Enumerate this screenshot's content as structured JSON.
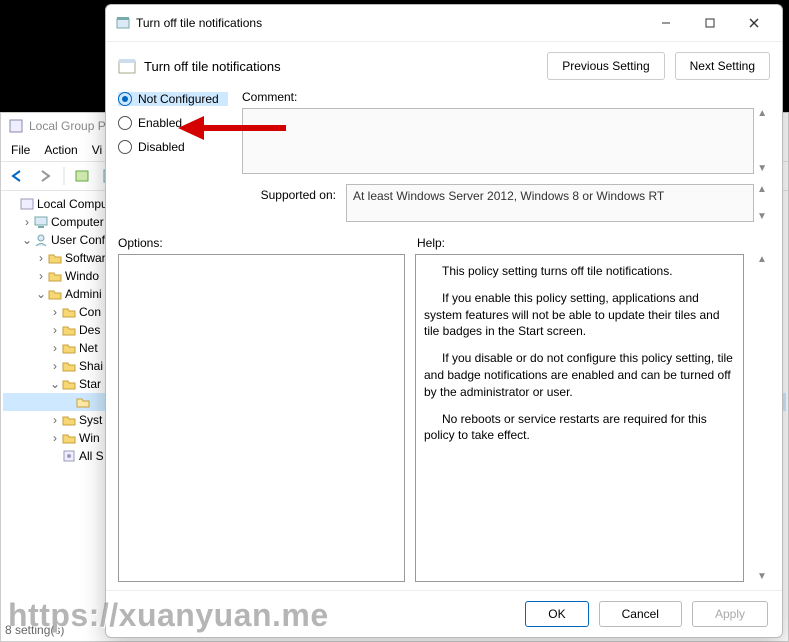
{
  "bg_window": {
    "title": "Local Group P",
    "menu": [
      "File",
      "Action",
      "Vi"
    ],
    "tree": [
      {
        "indent": 0,
        "exp": "",
        "icon": "policy",
        "label": "Local Compute"
      },
      {
        "indent": 1,
        "exp": ">",
        "icon": "computer",
        "label": "Computer"
      },
      {
        "indent": 1,
        "exp": "v",
        "icon": "user",
        "label": "User Config"
      },
      {
        "indent": 2,
        "exp": ">",
        "icon": "folder",
        "label": "Softwar"
      },
      {
        "indent": 2,
        "exp": ">",
        "icon": "folder",
        "label": "Windo"
      },
      {
        "indent": 2,
        "exp": "v",
        "icon": "folder",
        "label": "Admini"
      },
      {
        "indent": 3,
        "exp": ">",
        "icon": "folder",
        "label": "Con"
      },
      {
        "indent": 3,
        "exp": ">",
        "icon": "folder",
        "label": "Des"
      },
      {
        "indent": 3,
        "exp": ">",
        "icon": "folder",
        "label": "Net"
      },
      {
        "indent": 3,
        "exp": ">",
        "icon": "folder",
        "label": "Shai"
      },
      {
        "indent": 3,
        "exp": "v",
        "icon": "folder",
        "label": "Star"
      },
      {
        "indent": 4,
        "exp": "",
        "icon": "folder-sel",
        "label": ""
      },
      {
        "indent": 3,
        "exp": ">",
        "icon": "folder",
        "label": "Syst"
      },
      {
        "indent": 3,
        "exp": ">",
        "icon": "folder",
        "label": "Win"
      },
      {
        "indent": 3,
        "exp": "",
        "icon": "settings",
        "label": "All S"
      }
    ],
    "status": "8 setting(s)"
  },
  "dialog": {
    "title": "Turn off tile notifications",
    "header_title": "Turn off tile notifications",
    "prev_btn": "Previous Setting",
    "next_btn": "Next Setting",
    "radios": {
      "not_configured": "Not Configured",
      "enabled": "Enabled",
      "disabled": "Disabled"
    },
    "comment_label": "Comment:",
    "comment_value": "",
    "supported_label": "Supported on:",
    "supported_value": "At least Windows Server 2012, Windows 8 or Windows RT",
    "options_label": "Options:",
    "help_label": "Help:",
    "help_paragraphs": [
      "This policy setting turns off tile notifications.",
      "If you enable this policy setting, applications and system features will not be able to update their tiles and tile badges in the Start screen.",
      "If you disable or do not configure this policy setting, tile and badge notifications are enabled and can be turned off by the administrator or user.",
      "No reboots or service restarts are required for this policy to take effect."
    ],
    "ok": "OK",
    "cancel": "Cancel",
    "apply": "Apply"
  },
  "watermark": "https://xuanyuan.me"
}
